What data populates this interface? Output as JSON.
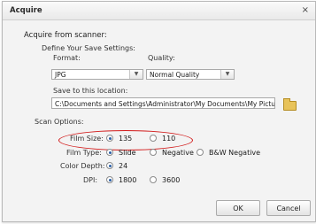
{
  "window": {
    "title": "Acquire",
    "close_glyph": "×"
  },
  "section_title": "Acquire from scanner:",
  "save_settings": {
    "heading": "Define Your Save Settings:",
    "format_label": "Format:",
    "format_value": "JPG",
    "quality_label": "Quality:",
    "quality_value": "Normal Quality",
    "location_label": "Save to this location:",
    "location_value": "C:\\Documents and Settings\\Administrator\\My Documents\\My Pictures"
  },
  "scan_options": {
    "heading": "Scan Options:",
    "film_size": {
      "label": "Film Size:",
      "options": [
        "135",
        "110"
      ],
      "selected": "135"
    },
    "film_type": {
      "label": "Film Type:",
      "options": [
        "Slide",
        "Negative",
        "B&W Negative"
      ],
      "selected": "Slide"
    },
    "color_depth": {
      "label": "Color Depth:",
      "options": [
        "24"
      ],
      "selected": "24"
    },
    "dpi": {
      "label": "DPI:",
      "options": [
        "1800",
        "3600"
      ],
      "selected": "1800"
    }
  },
  "buttons": {
    "ok": "OK",
    "cancel": "Cancel"
  },
  "colors": {
    "highlight": "#d21b1b",
    "radio_dot": "#2b5fa6"
  },
  "icons": {
    "close": "close-icon",
    "browse": "folder-icon",
    "dropdown": "chevron-down-icon"
  }
}
